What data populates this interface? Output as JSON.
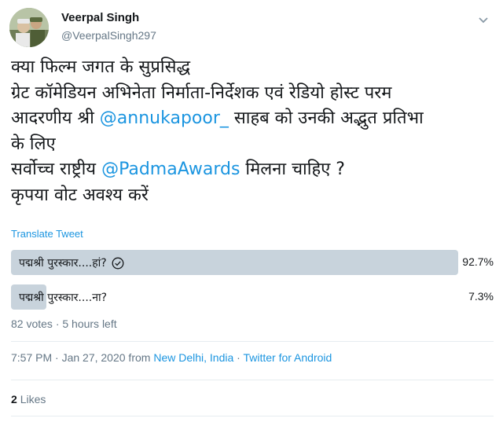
{
  "user": {
    "name": "Veerpal Singh",
    "handle": "@VeerpalSingh297"
  },
  "tweet": {
    "line1": "क्या फिल्म जगत के सुप्रसिद्ध",
    "line2": "ग्रेट कॉमेडियन अभिनेता निर्माता-निर्देशक एवं रेडियो होस्ट परम",
    "line3_before": "आदरणीय श्री ",
    "mention1": "@annukapoor_",
    "line3_after": " साहब को उनकी अद्भुत प्रतिभा",
    "line4": "के लिए",
    "line5_before": "सर्वोच्च राष्ट्रीय ",
    "mention2": "@PadmaAwards",
    "line5_after": " मिलना चाहिए ?",
    "line6": "कृपया वोट अवश्य करें"
  },
  "translate_label": "Translate Tweet",
  "poll": {
    "options": [
      {
        "label": "पद्मश्री पुरस्कार....हां?",
        "percent_text": "92.7%",
        "percent": 92.7,
        "selected": true
      },
      {
        "label": "पद्मश्री पुरस्कार....ना?",
        "percent_text": "7.3%",
        "percent": 7.3,
        "selected": false
      }
    ],
    "meta": "82 votes · 5 hours left"
  },
  "timestamp": {
    "time": "7:57 PM · Jan 27, 2020 from ",
    "location": "New Delhi, India",
    "sep": " · ",
    "source": "Twitter for Android"
  },
  "likes": {
    "count": "2",
    "label": "Likes"
  },
  "colors": {
    "link": "#1b95e0",
    "poll_bar": "#c8d3dc",
    "muted": "#657786"
  },
  "icons": [
    "avatar",
    "chevron-down-icon",
    "check-circle-icon"
  ]
}
